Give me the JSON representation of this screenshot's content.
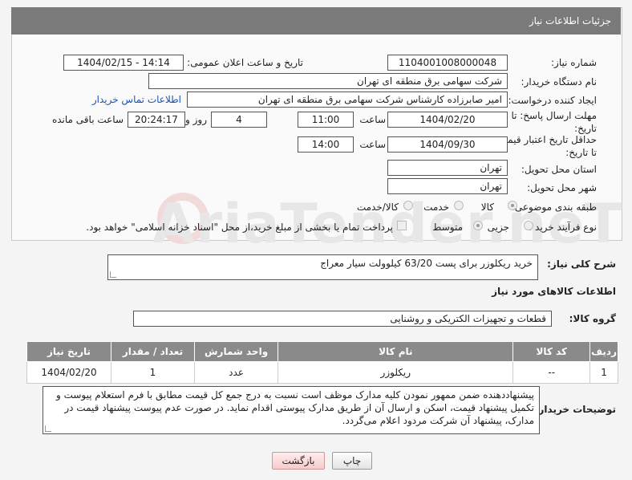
{
  "header": {
    "title": "جزئیات اطلاعات نیاز"
  },
  "form": {
    "need_number_label": "شماره نیاز:",
    "need_number": "1104001008000048",
    "announce_label": "تاریخ و ساعت اعلان عمومی:",
    "announce_value": "1404/02/15 - 14:14",
    "buyer_org_label": "نام دستگاه خریدار:",
    "buyer_org": "شرکت سهامی برق منطقه ای تهران",
    "creator_label": "ایجاد کننده درخواست:",
    "creator": "امیر صابرزاده کارشناس شرکت سهامی برق منطقه ای تهران",
    "contact_link": "اطلاعات تماس خریدار",
    "deadline_label": "مهلت ارسال پاسخ: تا تاریخ:",
    "deadline_date": "1404/02/20",
    "time_label": "ساعت",
    "deadline_time": "11:00",
    "days_value": "4",
    "days_label": "روز و",
    "remaining_time": "20:24:17",
    "remaining_label": "ساعت باقی مانده",
    "validity_label": "حداقل تاریخ اعتبار قیمت: تا تاریخ:",
    "validity_date": "1404/09/30",
    "validity_time_label": "ساعت",
    "validity_time": "14:00",
    "province_label": "استان محل تحویل:",
    "province": "تهران",
    "city_label": "شهر محل تحویل:",
    "city": "تهران",
    "category_label": "طبقه بندی موضوعی:",
    "category_options": [
      "کالا",
      "خدمت",
      "کالا/خدمت"
    ],
    "purchase_type_label": "نوع فرآیند خرید :",
    "purchase_options": [
      "جزیی",
      "متوسط"
    ],
    "treasury_note": "پرداخت تمام یا بخشی از مبلغ خرید،از محل \"اسناد خزانه اسلامی\" خواهد بود."
  },
  "description": {
    "label": "شرح کلی نیاز:",
    "value": "خرید ریکلوزر برای پست 63/20 کیلوولت سیار معراج"
  },
  "goods_section": {
    "title": "اطلاعات کالاهای مورد نیاز",
    "group_label": "گروه کالا:",
    "group_value": "قطعات و تجهیزات الکتریکی و روشنایی"
  },
  "table": {
    "headers": [
      "ردیف",
      "کد کالا",
      "نام کالا",
      "واحد شمارش",
      "تعداد / مقدار",
      "تاریخ نیاز"
    ],
    "rows": [
      [
        "1",
        "--",
        "ریکلوزر",
        "عدد",
        "1",
        "1404/02/20"
      ]
    ]
  },
  "buyer_notes": {
    "label": "توضیحات خریدار:",
    "value": "پیشنهاددهنده ضمن ممهور نمودن کلیه مدارک موظف است نسبت به درج جمع کل قیمت مطابق با فرم استعلام پیوست و تکمیل پیشنهاد قیمت، اسکن و ارسال آن از طریق مدارک پیوستی اقدام نماید. در صورت عدم پیوست پیشنهاد قیمت در مدارک، پیشنهاد آن شرکت مردود اعلام می‌گردد."
  },
  "buttons": {
    "print": "چاپ",
    "back": "بازگشت"
  },
  "watermark": {
    "text": "AriaTender.neT"
  }
}
